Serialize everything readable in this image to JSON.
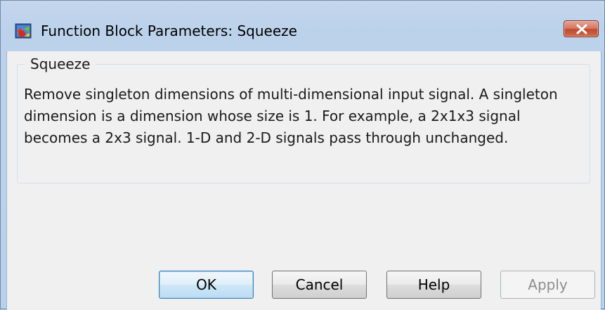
{
  "window": {
    "title": "Function Block Parameters: Squeeze",
    "icon": "simulink-block-icon",
    "close_icon": "close-icon"
  },
  "group": {
    "title": "Squeeze",
    "description": "Remove singleton dimensions of multi-dimensional input signal. A singleton dimension is a dimension whose size is 1. For example, a 2x1x3 signal becomes a 2x3 signal. 1-D and 2-D signals pass through unchanged."
  },
  "buttons": {
    "ok": "OK",
    "cancel": "Cancel",
    "help": "Help",
    "apply": "Apply"
  },
  "colors": {
    "titlebar": "#b9d1ea",
    "client": "#f0f0f0",
    "close_button": "#c14a2f",
    "default_button_border": "#3c7fb1",
    "disabled_text": "#8d8d8d"
  }
}
